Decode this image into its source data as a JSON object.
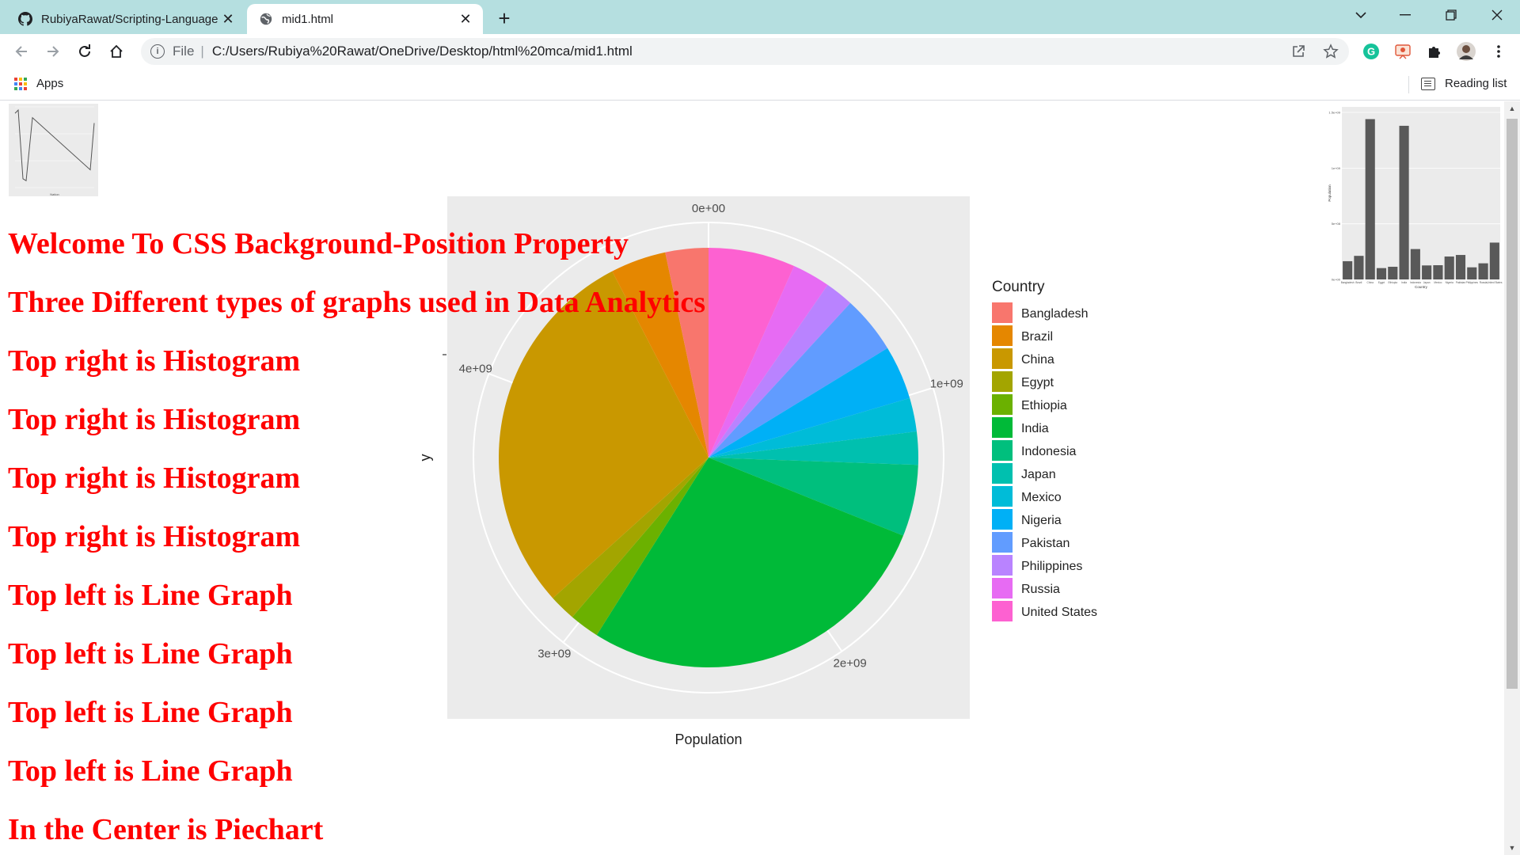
{
  "browser": {
    "tabs": [
      {
        "title": "RubiyaRawat/Scripting-Language",
        "active": false,
        "icon": "github-icon"
      },
      {
        "title": "mid1.html",
        "active": true,
        "icon": "globe-icon"
      }
    ],
    "omnibox": {
      "scheme": "File",
      "url": "C:/Users/Rubiya%20Rawat/OneDrive/Desktop/html%20mca/mid1.html"
    },
    "bookmarks": {
      "apps_label": "Apps",
      "reading_list_label": "Reading list"
    }
  },
  "page": {
    "headings": [
      "Welcome To CSS Background-Position Property",
      "Three Different types of graphs used in Data Analytics",
      "Top right is Histogram",
      "Top right is Histogram",
      "Top right is Histogram",
      "Top right is Histogram",
      "Top left is Line Graph",
      "Top left is Line Graph",
      "Top left is Line Graph",
      "Top left is Line Graph",
      "In the Center is Piechart"
    ],
    "heading_color": "#ff0000"
  },
  "chart_data": [
    {
      "type": "pie",
      "xlabel": "Population",
      "ylabel": "y",
      "legend_title": "Country",
      "legend_position": "right",
      "grid": true,
      "radial_ticks": [
        "0e+00",
        "1e+09",
        "2e+09",
        "3e+09",
        "4e+09"
      ],
      "categories": [
        "Bangladesh",
        "Brazil",
        "China",
        "Egypt",
        "Ethiopia",
        "India",
        "Indonesia",
        "Japan",
        "Mexico",
        "Nigeria",
        "Pakistan",
        "Philippines",
        "Russia",
        "United States"
      ],
      "values": [
        164000000,
        212000000,
        1440000000,
        102000000,
        114000000,
        1380000000,
        273000000,
        126000000,
        128000000,
        206000000,
        220000000,
        109000000,
        145000000,
        331000000
      ],
      "colors": [
        "#F8766D",
        "#E58700",
        "#C99800",
        "#A3A500",
        "#6BB100",
        "#00BA38",
        "#00BF7D",
        "#00C0AF",
        "#00BCD8",
        "#00B0F6",
        "#619CFF",
        "#B983FF",
        "#E76BF3",
        "#FD61D1"
      ]
    },
    {
      "type": "line",
      "thumbnail": true,
      "xlabel": "Nation",
      "ylabel": "",
      "values": [
        1380000000,
        1440000000,
        164000000,
        128000000,
        1300000000,
        331000000,
        1200000000
      ]
    },
    {
      "type": "bar",
      "thumbnail": true,
      "xlabel": "Country",
      "ylabel": "Population",
      "tick_labels_y": [
        "0e+00",
        "5e+08",
        "1e+09",
        "1.5e+09"
      ],
      "categories": [
        "Bangladesh",
        "Brazil",
        "China",
        "Egypt",
        "Ethiopia",
        "India",
        "Indonesia",
        "Japan",
        "Mexico",
        "Nigeria",
        "Pakistan",
        "Philippines",
        "Russia",
        "United States"
      ],
      "values": [
        164000000,
        212000000,
        1440000000,
        102000000,
        114000000,
        1380000000,
        273000000,
        126000000,
        128000000,
        206000000,
        220000000,
        109000000,
        145000000,
        331000000
      ]
    }
  ]
}
